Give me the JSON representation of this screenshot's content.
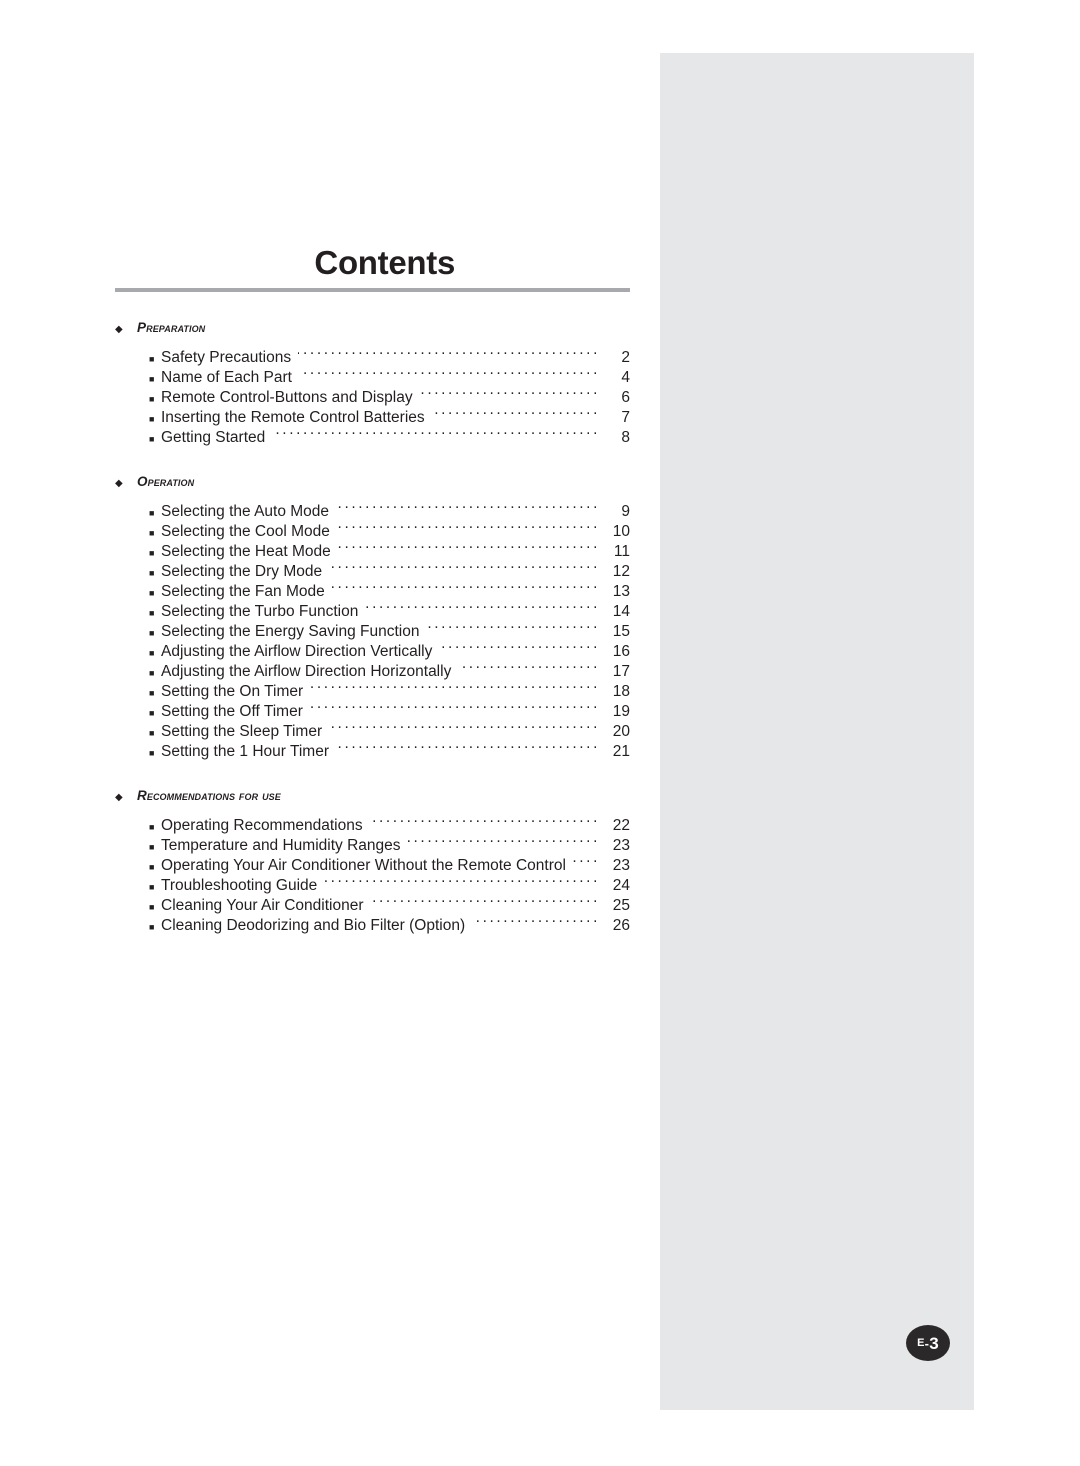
{
  "page": {
    "title": "Contents",
    "badge": {
      "prefix": "E",
      "separator": "-",
      "number": "3",
      "color": "#2b2829"
    },
    "rule_color": "#a7a9ac",
    "panel_color": "#e6e7e8",
    "text_color": "#231f20"
  },
  "icons": {
    "section_bullet": "◆",
    "item_bullet": "■"
  },
  "toc": {
    "sections": [
      {
        "title": "Preparation",
        "items": [
          {
            "label": "Safety Precautions",
            "page": "2"
          },
          {
            "label": "Name of Each Part",
            "page": "4"
          },
          {
            "label": "Remote Control‑Buttons and Display",
            "page": "6"
          },
          {
            "label": "Inserting the Remote Control Batteries",
            "page": "7"
          },
          {
            "label": "Getting Started",
            "page": "8"
          }
        ]
      },
      {
        "title": "Operation",
        "items": [
          {
            "label": "Selecting the Auto Mode",
            "page": "9"
          },
          {
            "label": "Selecting the Cool Mode",
            "page": "10"
          },
          {
            "label": "Selecting the Heat Mode",
            "page": "11"
          },
          {
            "label": "Selecting the Dry Mode",
            "page": "12"
          },
          {
            "label": "Selecting the Fan Mode",
            "page": "13"
          },
          {
            "label": "Selecting the Turbo Function",
            "page": "14"
          },
          {
            "label": "Selecting the Energy Saving Function",
            "page": "15"
          },
          {
            "label": "Adjusting the Airflow Direction Vertically",
            "page": "16"
          },
          {
            "label": "Adjusting the Airflow Direction Horizontally",
            "page": "17"
          },
          {
            "label": "Setting the On Timer",
            "page": "18"
          },
          {
            "label": "Setting the Off Timer",
            "page": "19"
          },
          {
            "label": "Setting the Sleep Timer",
            "page": "20"
          },
          {
            "label": "Setting the 1 Hour Timer",
            "page": "21"
          }
        ]
      },
      {
        "title": "Recommendations for use",
        "items": [
          {
            "label": "Operating Recommendations",
            "page": "22"
          },
          {
            "label": "Temperature and Humidity Ranges",
            "page": "23"
          },
          {
            "label": "Operating Your Air Conditioner Without the Remote Control",
            "page": "23"
          },
          {
            "label": "Troubleshooting Guide",
            "page": "24"
          },
          {
            "label": "Cleaning Your Air Conditioner",
            "page": "25"
          },
          {
            "label": "Cleaning Deodorizing and Bio Filter (Option)",
            "page": "26"
          }
        ]
      }
    ]
  }
}
